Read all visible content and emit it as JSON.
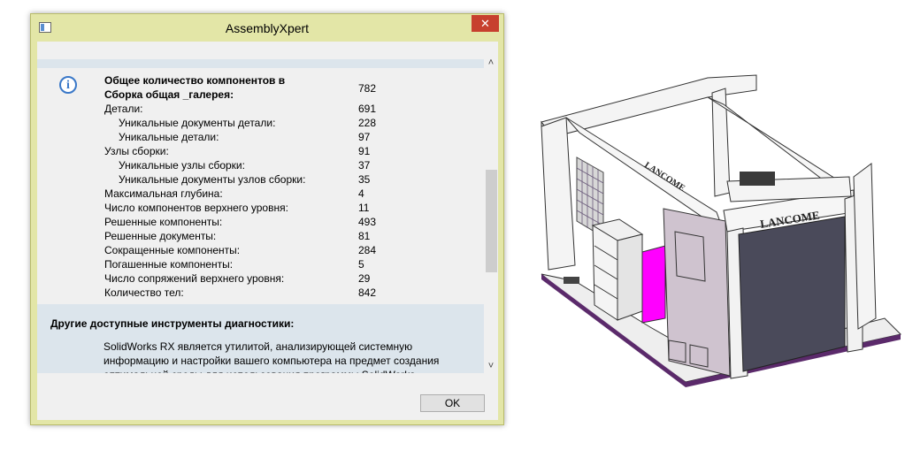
{
  "window": {
    "title": "AssemblyXpert",
    "close_glyph": "✕",
    "ok_label": "OK"
  },
  "summary": {
    "header_line1": "Общее количество компонентов в",
    "header_line2": "Сборка общая _галерея:",
    "header_value": "782",
    "rows": [
      {
        "label": "Детали:",
        "value": "691",
        "indent": false
      },
      {
        "label": "Уникальные документы детали:",
        "value": "228",
        "indent": true
      },
      {
        "label": "Уникальные детали:",
        "value": "97",
        "indent": true
      },
      {
        "label": "Узлы сборки:",
        "value": "91",
        "indent": false
      },
      {
        "label": "Уникальные узлы сборки:",
        "value": "37",
        "indent": true
      },
      {
        "label": "Уникальные документы узлов сборки:",
        "value": "35",
        "indent": true
      },
      {
        "label": "Максимальная глубина:",
        "value": "4",
        "indent": false
      },
      {
        "label": "Число компонентов верхнего уровня:",
        "value": "11",
        "indent": false
      },
      {
        "label": "Решенные компоненты:",
        "value": "493",
        "indent": false
      },
      {
        "label": "Решенные документы:",
        "value": "81",
        "indent": false
      },
      {
        "label": "Сокращенные компоненты:",
        "value": "284",
        "indent": false
      },
      {
        "label": "Погашенные компоненты:",
        "value": "5",
        "indent": false
      },
      {
        "label": "Число сопряжений верхнего уровня:",
        "value": "29",
        "indent": false
      },
      {
        "label": "Количество тел:",
        "value": "842",
        "indent": false
      }
    ]
  },
  "diagnostics": {
    "heading": "Другие доступные инструменты диагностики:",
    "text": "SolidWorks RX является утилитой, анализирующей системную информацию и настройки вашего компьютера на предмет создания оптимальной среды для использования программы SolidWorks."
  },
  "model": {
    "brand_front": "LANCOME",
    "brand_side": "LANCOME"
  },
  "icons": {
    "info": "info-icon",
    "scroll_up": "chevron-up-icon",
    "scroll_down": "chevron-down-icon"
  },
  "colors": {
    "dialog_frame": "#e3e6a7",
    "close_button": "#c7402e",
    "panel_blue": "#dce5ec",
    "magenta": "#ff00ff",
    "floor": "#5b2a6b"
  }
}
